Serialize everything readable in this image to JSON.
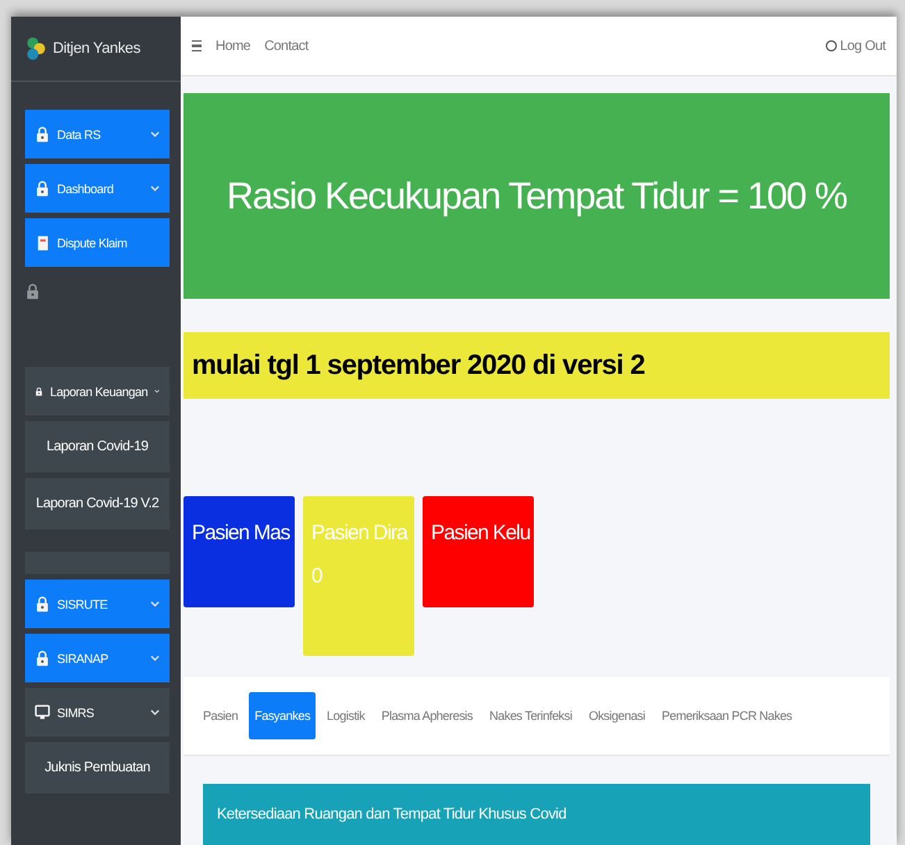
{
  "brand": {
    "title": "Ditjen Yankes"
  },
  "sidebar": {
    "items": [
      {
        "kind": "locked",
        "label": "Data RS",
        "highlighted": true
      },
      {
        "kind": "locked",
        "label": "Dashboard",
        "highlighted": true
      },
      {
        "kind": "document",
        "label": "Dispute Klaim",
        "highlighted": true
      },
      {
        "kind": "lock"
      },
      {
        "kind": "locked",
        "label": "Laporan Keuangan",
        "highlighted": false
      },
      {
        "kind": "sub",
        "label": "Laporan Covid-19"
      },
      {
        "kind": "sub",
        "label": "Laporan Covid-19 V.2"
      },
      {
        "kind": "spacer"
      },
      {
        "kind": "locked",
        "label": "SISRUTE",
        "highlighted": true
      },
      {
        "kind": "locked",
        "label": "SIRANAP",
        "highlighted": true
      },
      {
        "kind": "device",
        "label": "SIMRS",
        "highlighted": false
      },
      {
        "kind": "sub",
        "label": "Juknis Pembuatan"
      }
    ]
  },
  "navbar": {
    "links": [
      "Home",
      "Contact"
    ],
    "logout": "Log Out"
  },
  "banner": {
    "text": "Rasio Kecukupan Tempat Tidur = 100 %"
  },
  "marquee": {
    "text": "mulai tgl 1 september 2020 di versi 2"
  },
  "stat_boxes": [
    {
      "label": "Pasien Mas",
      "color": "#0a2fe0"
    },
    {
      "label": "Pasien Dira",
      "value": "0",
      "color": "#ece83a"
    },
    {
      "label": "Pasien Kelu",
      "color": "#ff0000"
    }
  ],
  "tabs": [
    {
      "label": "Pasien",
      "selected": false
    },
    {
      "label": "Fasyankes",
      "selected": true
    },
    {
      "label": "Logistik",
      "selected": false
    },
    {
      "label": "Plasma Apheresis",
      "selected": false
    },
    {
      "label": "Nakes Terinfeksi",
      "selected": false
    },
    {
      "label": "Oksigenasi",
      "selected": false
    },
    {
      "label": "Pemeriksaan PCR Nakes",
      "selected": false
    }
  ],
  "card": {
    "title": "Ketersediaan Ruangan dan Tempat Tidur Khusus Covid"
  }
}
